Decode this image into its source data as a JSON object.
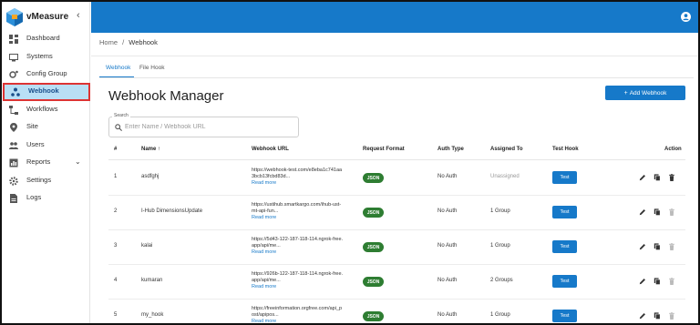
{
  "app": {
    "name": "vMeasure",
    "collapse_glyph": "‹"
  },
  "colors": {
    "primary": "#1679c9",
    "json_badge": "#2e7d32",
    "active_nav_bg": "#b9dff5",
    "highlight_border": "#dd3333"
  },
  "sidebar": {
    "items": [
      {
        "label": "Dashboard",
        "icon": "dashboard-icon"
      },
      {
        "label": "Systems",
        "icon": "systems-icon"
      },
      {
        "label": "Config Group",
        "icon": "config-group-icon"
      },
      {
        "label": "Webhook",
        "icon": "webhook-icon",
        "active": true
      },
      {
        "label": "Workflows",
        "icon": "workflows-icon"
      },
      {
        "label": "Site",
        "icon": "site-icon"
      },
      {
        "label": "Users",
        "icon": "users-icon"
      },
      {
        "label": "Reports",
        "icon": "reports-icon",
        "expandable": true
      },
      {
        "label": "Settings",
        "icon": "settings-icon"
      },
      {
        "label": "Logs",
        "icon": "logs-icon"
      }
    ],
    "reports_chevron": "⌄"
  },
  "breadcrumb": {
    "home": "Home",
    "separator": "/",
    "current": "Webhook"
  },
  "tabs": [
    {
      "label": "Webhook",
      "active": true
    },
    {
      "label": "File Hook"
    }
  ],
  "page": {
    "title": "Webhook Manager",
    "add_button": "Add Webhook",
    "add_glyph": "+"
  },
  "search": {
    "label": "Search",
    "placeholder": "Enter Name / Webhook URL",
    "value": ""
  },
  "table": {
    "headers": {
      "num": "#",
      "name": "Name",
      "sort_glyph": "↑",
      "url": "Webhook URL",
      "format": "Request Format",
      "auth": "Auth Type",
      "assigned": "Assigned To",
      "test": "Test Hook",
      "action": "Action"
    },
    "rows": [
      {
        "num": "1",
        "name": "asdfghj",
        "url_line1": "https://webhook-test.com/e8eba1c741aa",
        "url_line2": "3bcb13fcbd83d...",
        "read_more": "Read more",
        "format": "JSON",
        "auth": "No Auth",
        "assigned": "Unassigned",
        "assigned_muted": true,
        "test": "Test",
        "delete_enabled": true
      },
      {
        "num": "2",
        "name": "I-Hub DimensionsUpdate",
        "url_line1": "https://ustihub.smartkargo.com/ihub-ust-",
        "url_line2": "mt-api-fun...",
        "read_more": "Read more",
        "format": "JSON",
        "auth": "No Auth",
        "assigned": "1 Group",
        "assigned_muted": false,
        "test": "Test",
        "delete_enabled": false
      },
      {
        "num": "3",
        "name": "kalai",
        "url_line1": "https://5d43-122-187-118-114.ngrok-free.",
        "url_line2": "app/api/me...",
        "read_more": "Read more",
        "format": "JSON",
        "auth": "No Auth",
        "assigned": "1 Group",
        "assigned_muted": false,
        "test": "Test",
        "delete_enabled": false
      },
      {
        "num": "4",
        "name": "kumaran",
        "url_line1": "https://926b-122-187-118-114.ngrok-free.",
        "url_line2": "app/api/me...",
        "read_more": "Read more",
        "format": "JSON",
        "auth": "No Auth",
        "assigned": "2 Groups",
        "assigned_muted": false,
        "test": "Test",
        "delete_enabled": false
      },
      {
        "num": "5",
        "name": "my_hook",
        "url_line1": "https://freeinformation.orgfree.com/api_p",
        "url_line2": "ost/apipos...",
        "read_more": "Read more",
        "format": "JSON",
        "auth": "No Auth",
        "assigned": "1 Group",
        "assigned_muted": false,
        "test": "Test",
        "delete_enabled": false
      }
    ]
  }
}
